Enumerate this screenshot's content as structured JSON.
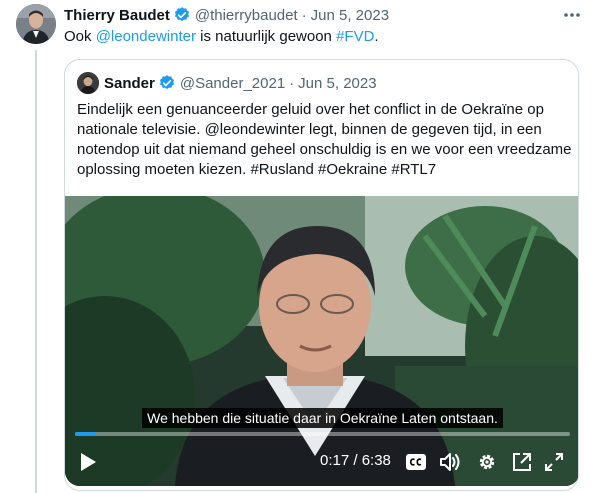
{
  "tweet": {
    "author_name": "Thierry Baudet",
    "handle": "@thierrybaudet",
    "separator": "·",
    "date": "Jun 5, 2023",
    "text_prefix": "Ook ",
    "mention": "@leondewinter",
    "text_middle": " is natuurlijk gewoon ",
    "hashtag": "#FVD",
    "text_suffix": "."
  },
  "quote": {
    "author_name": "Sander",
    "handle": "@Sander_2021",
    "separator": "·",
    "date": "Jun 5, 2023",
    "text": "Eindelijk een genuanceerder geluid over het conflict in de Oekraïne op nationale televisie. @leondewinter legt, binnen de gegeven tijd, in een notendop uit dat niemand geheel onschuldig is en we voor een vreedzame oplossing moeten kiezen. #Rusland #Oekraine #RTL7"
  },
  "video": {
    "subtitle": "We hebben die situatie daar in Oekraïne Laten ontstaan.",
    "time": "0:17 / 6:38",
    "progress": 0.043
  },
  "colors": {
    "accent": "#1d9bf0",
    "muted": "#536471",
    "text": "#0f1419",
    "border": "#cfd9de"
  }
}
